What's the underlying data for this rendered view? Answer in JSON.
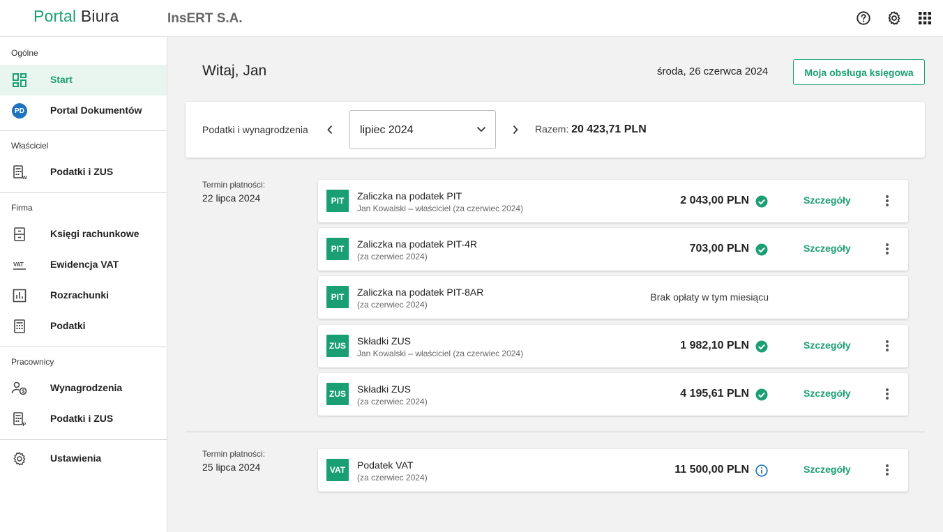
{
  "header": {
    "logo_part1": "Portal",
    "logo_part2": "Biura",
    "company": "InsERT S.A.",
    "icons": [
      "help-icon",
      "settings-gear-icon",
      "apps-grid-icon"
    ]
  },
  "sidebar": {
    "sections": [
      {
        "title": "Ogólne",
        "items": [
          {
            "label": "Start",
            "icon": "dashboard-icon",
            "active": true
          },
          {
            "label": "Portal Dokumentów",
            "icon": "pd-badge",
            "badge": "PD"
          }
        ]
      },
      {
        "title": "Właściciel",
        "items": [
          {
            "label": "Podatki i ZUS",
            "icon": "calculator-w-icon"
          }
        ]
      },
      {
        "title": "Firma",
        "items": [
          {
            "label": "Księgi rachunkowe",
            "icon": "ledger-icon"
          },
          {
            "label": "Ewidencja VAT",
            "icon": "vat-icon"
          },
          {
            "label": "Rozrachunki",
            "icon": "bar-chart-icon"
          },
          {
            "label": "Podatki",
            "icon": "calculator-icon"
          }
        ]
      },
      {
        "title": "Pracownicy",
        "items": [
          {
            "label": "Wynagrodzenia",
            "icon": "person-money-icon"
          },
          {
            "label": "Podatki i ZUS",
            "icon": "calculator-p-icon"
          }
        ]
      },
      {
        "title": "",
        "items": [
          {
            "label": "Ustawienia",
            "icon": "settings-gear-icon"
          }
        ]
      }
    ]
  },
  "main": {
    "greeting": "Witaj, Jan",
    "date": "środa, 26 czerwca 2024",
    "accounting_button": "Moja obsługa księgowa",
    "filter": {
      "label": "Podatki i wynagrodzenia",
      "month": "lipiec 2024",
      "total_label": "Razem:",
      "total_value": "20 423,71 PLN"
    },
    "groups": [
      {
        "term_label": "Termin płatności:",
        "term_date": "22 lipca 2024",
        "rows": [
          {
            "tag": "PIT",
            "title": "Zaliczka na podatek PIT",
            "subtitle": "Jan Kowalski – właściciel (za czerwiec 2024)",
            "amount": "2 043,00 PLN",
            "status": "paid",
            "details": "Szczegóły"
          },
          {
            "tag": "PIT",
            "title": "Zaliczka na podatek PIT-4R",
            "subtitle": "(za czerwiec 2024)",
            "amount": "703,00 PLN",
            "status": "paid",
            "details": "Szczegóły"
          },
          {
            "tag": "PIT",
            "title": "Zaliczka na podatek PIT-8AR",
            "subtitle": "(za czerwiec 2024)",
            "note": "Brak opłaty w tym miesiącu"
          },
          {
            "tag": "ZUS",
            "title": "Składki ZUS",
            "subtitle": "Jan Kowalski – właściciel (za czerwiec 2024)",
            "amount": "1 982,10 PLN",
            "status": "paid",
            "details": "Szczegóły"
          },
          {
            "tag": "ZUS",
            "title": "Składki ZUS",
            "subtitle": "(za czerwiec 2024)",
            "amount": "4 195,61 PLN",
            "status": "paid",
            "details": "Szczegóły"
          }
        ]
      },
      {
        "term_label": "Termin płatności:",
        "term_date": "25 lipca 2024",
        "rows": [
          {
            "tag": "VAT",
            "title": "Podatek VAT",
            "subtitle": "(za czerwiec 2024)",
            "amount": "11 500,00 PLN",
            "status": "info",
            "details": "Szczegóły"
          }
        ]
      }
    ]
  },
  "colors": {
    "accent": "#1a9f74",
    "info": "#1e73be"
  }
}
